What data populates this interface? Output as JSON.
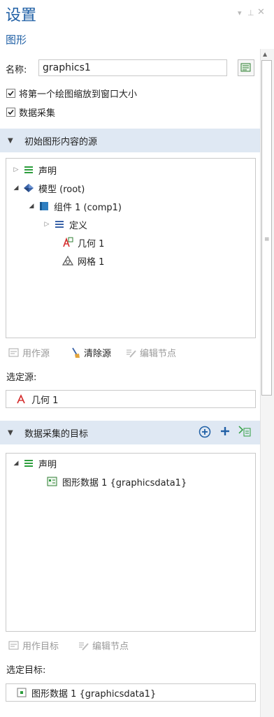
{
  "header": {
    "title": "设置",
    "subtitle": "图形",
    "win_controls": "▾ ⊥ ✕"
  },
  "name_field": {
    "label": "名称:",
    "value": "graphics1"
  },
  "checkboxes": [
    {
      "label": "将第一个绘图缩放到窗口大小",
      "checked": true
    },
    {
      "label": "数据采集",
      "checked": true
    }
  ],
  "source_section": {
    "title": "初始图形内容的源",
    "tree": [
      {
        "label": "声明",
        "toggle": "▷",
        "icon": "equals-icon"
      },
      {
        "label": "模型 (root)",
        "toggle": "◢",
        "icon": "model-icon"
      },
      {
        "label": "组件 1 (comp1)",
        "toggle": "◢",
        "icon": "component-icon"
      },
      {
        "label": "定义",
        "toggle": "▷",
        "icon": "equals-icon"
      },
      {
        "label": "几何 1",
        "toggle": "",
        "icon": "geometry-icon"
      },
      {
        "label": "网格 1",
        "toggle": "",
        "icon": "mesh-icon"
      }
    ],
    "toolbar": {
      "use_as_source": "用作源",
      "clear_source": "清除源",
      "edit_node": "编辑节点"
    },
    "selected_label": "选定源:",
    "selected_value": "几何 1"
  },
  "target_section": {
    "title": "数据采集的目标",
    "tree": [
      {
        "label": "声明",
        "toggle": "◢",
        "icon": "equals-icon"
      },
      {
        "label": "图形数据 1 {graphicsdata1}",
        "toggle": "",
        "icon": "graphics-data-icon"
      }
    ],
    "toolbar": {
      "use_as_target": "用作目标",
      "edit_node": "编辑节点"
    },
    "selected_label": "选定目标:",
    "selected_value": "图形数据 1 {graphicsdata1}"
  },
  "colors": {
    "accent": "#1f5fa5",
    "section_bg": "#dfe8f3",
    "green": "#2e9e3e",
    "red": "#d42a2a"
  }
}
